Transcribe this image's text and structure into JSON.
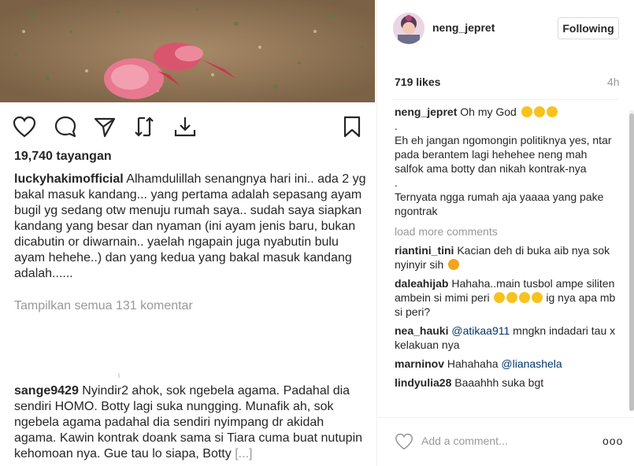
{
  "post": {
    "views": "19,740 tayangan",
    "caption_user": "luckyhakimofficial",
    "caption_text": "Alhamdulillah senangnya hari ini.. ada 2 yg bakal masuk kandang... yang pertama adalah sepasang ayam bugil yg sedang otw menuju rumah saya.. sudah saya siapkan kandang yang besar dan nyaman (ini ayam jenis baru, bukan dicabutin or diwarnain.. yaelah ngapain juga nyabutin bulu ayam hehehe..) dan yang kedua yang bakal masuk kandang adalah......",
    "show_all": "Tampilkan semua 131 komentar",
    "comment_user": "sange9429",
    "comment_text": "Nyindir2 ahok, sok ngebela agama. Padahal dia sendiri HOMO. Botty lagi suka nungging.  Munafik ah, sok ngebela agama padahal dia sendiri nyimpang dr akidah agama. Kawin kontrak doank sama si Tiara cuma buat nutupin kehomoan nya.  Gue tau lo siapa, Botty",
    "comment_more": "[...]"
  },
  "icons": {
    "like": "heart-icon",
    "comment": "comment-bubble-icon",
    "share": "paper-plane-icon",
    "repost": "repost-icon",
    "download": "download-icon",
    "save": "bookmark-icon"
  },
  "side": {
    "username": "neng_jepret",
    "follow_label": "Following",
    "likes": "719 likes",
    "time": "4h",
    "owner_comment_user": "neng_jepret",
    "owner_comment_first": "Oh my God",
    "owner_lines": [
      ".",
      "Eh eh jangan ngomongin politiknya yes, ntar pada berantem lagi hehehee neng mah salfok ama botty dan nikah kontrak-nya",
      ".",
      "Ternyata ngga rumah aja yaaaa yang pake ngontrak"
    ],
    "load_more": "load more comments",
    "comments": [
      {
        "user": "riantini_tini",
        "text": "Kacian deh di buka aib nya sok nyinyir sih"
      },
      {
        "user": "daleahijab",
        "text": "Hahaha..main tusbol ampe siliten ambein si mimi peri",
        "text2": "ig nya apa mb si peri?"
      },
      {
        "user": "nea_hauki",
        "mention": "@atikaa911",
        "text": "mngkn indadari tau x kelakuan nya"
      },
      {
        "user": "marninov",
        "text": "Hahahaha",
        "mention": "@lianashela"
      },
      {
        "user": "lindyulia28",
        "text": "Baaahhh suka bgt"
      }
    ],
    "add_comment": "Add a comment...",
    "more_dots": "ooo"
  },
  "colors": {
    "text": "#262626",
    "muted": "#999999",
    "border": "#dbdbdb",
    "mention": "#003569"
  }
}
